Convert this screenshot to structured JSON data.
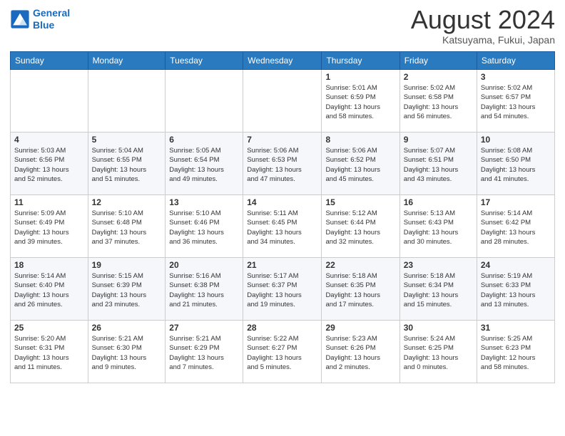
{
  "logo": {
    "line1": "General",
    "line2": "Blue"
  },
  "title": "August 2024",
  "location": "Katsuyama, Fukui, Japan",
  "days_of_week": [
    "Sunday",
    "Monday",
    "Tuesday",
    "Wednesday",
    "Thursday",
    "Friday",
    "Saturday"
  ],
  "weeks": [
    [
      {
        "day": "",
        "info": ""
      },
      {
        "day": "",
        "info": ""
      },
      {
        "day": "",
        "info": ""
      },
      {
        "day": "",
        "info": ""
      },
      {
        "day": "1",
        "info": "Sunrise: 5:01 AM\nSunset: 6:59 PM\nDaylight: 13 hours\nand 58 minutes."
      },
      {
        "day": "2",
        "info": "Sunrise: 5:02 AM\nSunset: 6:58 PM\nDaylight: 13 hours\nand 56 minutes."
      },
      {
        "day": "3",
        "info": "Sunrise: 5:02 AM\nSunset: 6:57 PM\nDaylight: 13 hours\nand 54 minutes."
      }
    ],
    [
      {
        "day": "4",
        "info": "Sunrise: 5:03 AM\nSunset: 6:56 PM\nDaylight: 13 hours\nand 52 minutes."
      },
      {
        "day": "5",
        "info": "Sunrise: 5:04 AM\nSunset: 6:55 PM\nDaylight: 13 hours\nand 51 minutes."
      },
      {
        "day": "6",
        "info": "Sunrise: 5:05 AM\nSunset: 6:54 PM\nDaylight: 13 hours\nand 49 minutes."
      },
      {
        "day": "7",
        "info": "Sunrise: 5:06 AM\nSunset: 6:53 PM\nDaylight: 13 hours\nand 47 minutes."
      },
      {
        "day": "8",
        "info": "Sunrise: 5:06 AM\nSunset: 6:52 PM\nDaylight: 13 hours\nand 45 minutes."
      },
      {
        "day": "9",
        "info": "Sunrise: 5:07 AM\nSunset: 6:51 PM\nDaylight: 13 hours\nand 43 minutes."
      },
      {
        "day": "10",
        "info": "Sunrise: 5:08 AM\nSunset: 6:50 PM\nDaylight: 13 hours\nand 41 minutes."
      }
    ],
    [
      {
        "day": "11",
        "info": "Sunrise: 5:09 AM\nSunset: 6:49 PM\nDaylight: 13 hours\nand 39 minutes."
      },
      {
        "day": "12",
        "info": "Sunrise: 5:10 AM\nSunset: 6:48 PM\nDaylight: 13 hours\nand 37 minutes."
      },
      {
        "day": "13",
        "info": "Sunrise: 5:10 AM\nSunset: 6:46 PM\nDaylight: 13 hours\nand 36 minutes."
      },
      {
        "day": "14",
        "info": "Sunrise: 5:11 AM\nSunset: 6:45 PM\nDaylight: 13 hours\nand 34 minutes."
      },
      {
        "day": "15",
        "info": "Sunrise: 5:12 AM\nSunset: 6:44 PM\nDaylight: 13 hours\nand 32 minutes."
      },
      {
        "day": "16",
        "info": "Sunrise: 5:13 AM\nSunset: 6:43 PM\nDaylight: 13 hours\nand 30 minutes."
      },
      {
        "day": "17",
        "info": "Sunrise: 5:14 AM\nSunset: 6:42 PM\nDaylight: 13 hours\nand 28 minutes."
      }
    ],
    [
      {
        "day": "18",
        "info": "Sunrise: 5:14 AM\nSunset: 6:40 PM\nDaylight: 13 hours\nand 26 minutes."
      },
      {
        "day": "19",
        "info": "Sunrise: 5:15 AM\nSunset: 6:39 PM\nDaylight: 13 hours\nand 23 minutes."
      },
      {
        "day": "20",
        "info": "Sunrise: 5:16 AM\nSunset: 6:38 PM\nDaylight: 13 hours\nand 21 minutes."
      },
      {
        "day": "21",
        "info": "Sunrise: 5:17 AM\nSunset: 6:37 PM\nDaylight: 13 hours\nand 19 minutes."
      },
      {
        "day": "22",
        "info": "Sunrise: 5:18 AM\nSunset: 6:35 PM\nDaylight: 13 hours\nand 17 minutes."
      },
      {
        "day": "23",
        "info": "Sunrise: 5:18 AM\nSunset: 6:34 PM\nDaylight: 13 hours\nand 15 minutes."
      },
      {
        "day": "24",
        "info": "Sunrise: 5:19 AM\nSunset: 6:33 PM\nDaylight: 13 hours\nand 13 minutes."
      }
    ],
    [
      {
        "day": "25",
        "info": "Sunrise: 5:20 AM\nSunset: 6:31 PM\nDaylight: 13 hours\nand 11 minutes."
      },
      {
        "day": "26",
        "info": "Sunrise: 5:21 AM\nSunset: 6:30 PM\nDaylight: 13 hours\nand 9 minutes."
      },
      {
        "day": "27",
        "info": "Sunrise: 5:21 AM\nSunset: 6:29 PM\nDaylight: 13 hours\nand 7 minutes."
      },
      {
        "day": "28",
        "info": "Sunrise: 5:22 AM\nSunset: 6:27 PM\nDaylight: 13 hours\nand 5 minutes."
      },
      {
        "day": "29",
        "info": "Sunrise: 5:23 AM\nSunset: 6:26 PM\nDaylight: 13 hours\nand 2 minutes."
      },
      {
        "day": "30",
        "info": "Sunrise: 5:24 AM\nSunset: 6:25 PM\nDaylight: 13 hours\nand 0 minutes."
      },
      {
        "day": "31",
        "info": "Sunrise: 5:25 AM\nSunset: 6:23 PM\nDaylight: 12 hours\nand 58 minutes."
      }
    ]
  ]
}
